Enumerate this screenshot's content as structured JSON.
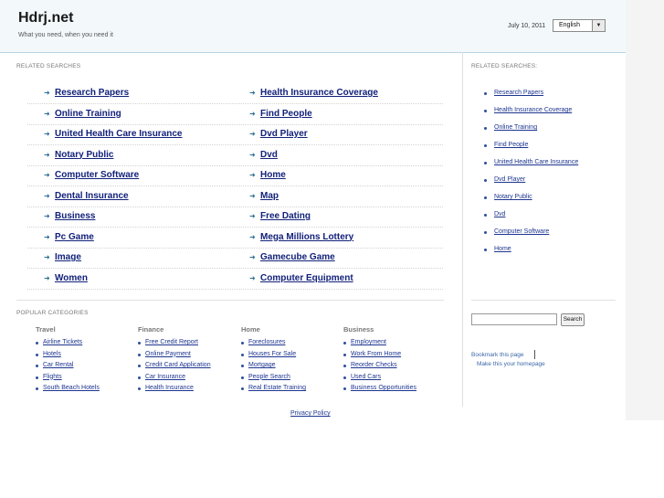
{
  "header": {
    "site_title": "Hdrj.net",
    "tagline": "What you need, when you need it",
    "date": "July 10, 2011",
    "language_selected": "English"
  },
  "main": {
    "section_title": "RELATED SEARCHES",
    "left_links": [
      "Research Papers",
      "Online Training",
      "United Health Care Insurance",
      "Notary Public",
      "Computer Software",
      "Dental Insurance",
      "Business",
      "Pc Game",
      "Image",
      "Women"
    ],
    "right_links": [
      "Health Insurance Coverage",
      "Find People",
      "Dvd Player",
      "Dvd",
      "Home",
      "Map",
      "Free Dating",
      "Mega Millions Lottery",
      "Gamecube Game",
      "Computer Equipment"
    ]
  },
  "sidebar": {
    "section_title": "RELATED SEARCHES:",
    "links": [
      "Research Papers",
      "Health Insurance Coverage",
      "Online Training",
      "Find People",
      "United Health Care Insurance",
      "Dvd Player",
      "Notary Public",
      "Dvd",
      "Computer Software",
      "Home"
    ],
    "search_button": "Search",
    "bookmark": "Bookmark this page",
    "homepage": "Make this your homepage"
  },
  "popular": {
    "section_title": "POPULAR CATEGORIES",
    "categories": [
      {
        "title": "Travel",
        "items": [
          "Airline Tickets",
          "Hotels",
          "Car Rental",
          "Flights",
          "South Beach Hotels"
        ]
      },
      {
        "title": "Finance",
        "items": [
          "Free Credit Report",
          "Online Payment",
          "Credit Card Application",
          "Car Insurance",
          "Health Insurance"
        ]
      },
      {
        "title": "Home",
        "items": [
          "Foreclosures",
          "Houses For Sale",
          "Mortgage",
          "People Search",
          "Real Estate Training"
        ]
      },
      {
        "title": "Business",
        "items": [
          "Employment",
          "Work From Home",
          "Reorder Checks",
          "Used Cars",
          "Business Opportunities"
        ]
      }
    ]
  },
  "footer": {
    "privacy": "Privacy Policy"
  },
  "icons": {
    "bullet_arrow": "arrow-right-icon",
    "dropdown": "chevron-down-icon"
  },
  "colors": {
    "link": "#12217a",
    "header_bg": "#f3f8fb",
    "header_border": "#b9d4e4"
  }
}
